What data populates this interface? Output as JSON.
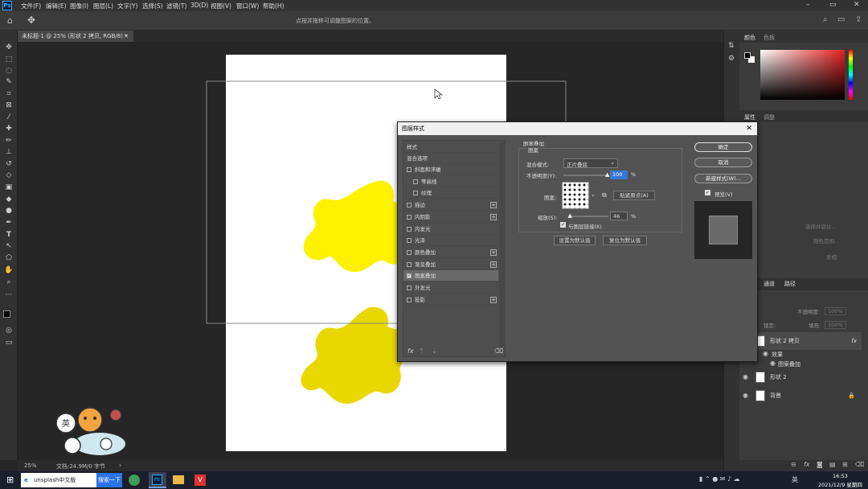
{
  "app": {
    "logo": "Ps",
    "hint": "点按并拖移可调整图案的位置。"
  },
  "menu": [
    "文件(F)",
    "编辑(E)",
    "图像(I)",
    "图层(L)",
    "文字(Y)",
    "选择(S)",
    "滤镜(T)",
    "3D(D)",
    "视图(V)",
    "窗口(W)",
    "帮助(H)"
  ],
  "doc": {
    "tab": "未标题-1 @ 25% (形状 2 拷贝, RGB/8) *",
    "close": "×",
    "zoom": "25%",
    "info": "文档:24.9M/0 字节"
  },
  "panels": {
    "color_tab": "颜色",
    "swatch_tab": "色板",
    "props_tab": "属性",
    "adjust_tab": "调整",
    "channels_tab": "通道",
    "paths_tab": "路径",
    "opacity_label": "不透明度:",
    "opacity_value": "100%",
    "fill_label": "填充:",
    "fill_value": "100%",
    "lock_label": "锁定:"
  },
  "layers": [
    {
      "name": "形状 2 拷贝",
      "fx": "fx"
    },
    {
      "name": "效果"
    },
    {
      "name": "图案叠加"
    },
    {
      "name": "形状 2"
    },
    {
      "name": "背景"
    }
  ],
  "dialog": {
    "title": "图层样式",
    "close": "✕",
    "styles_header": "样式",
    "blend_options": "混合选项",
    "effects": [
      {
        "label": "斜面和浮雕",
        "plus": false,
        "checked": false
      },
      {
        "label": "等高线",
        "plus": false,
        "checked": false,
        "indent": true
      },
      {
        "label": "纹理",
        "plus": false,
        "checked": false,
        "indent": true
      },
      {
        "label": "描边",
        "plus": true,
        "checked": false
      },
      {
        "label": "内阴影",
        "plus": true,
        "checked": false
      },
      {
        "label": "内发光",
        "plus": false,
        "checked": false
      },
      {
        "label": "光泽",
        "plus": false,
        "checked": false
      },
      {
        "label": "颜色叠加",
        "plus": true,
        "checked": false
      },
      {
        "label": "渐变叠加",
        "plus": true,
        "checked": false
      },
      {
        "label": "图案叠加",
        "plus": false,
        "checked": true
      },
      {
        "label": "外发光",
        "plus": false,
        "checked": false
      },
      {
        "label": "投影",
        "plus": true,
        "checked": false
      }
    ],
    "section_title": "图案叠加",
    "group_title": "图案",
    "blend_mode_label": "混合模式:",
    "blend_mode_value": "正片叠底",
    "opacity_label": "不透明度(Y):",
    "opacity_value": "100",
    "opacity_pct": "%",
    "opacity_level": 1.0,
    "pattern_label": "图案:",
    "snap_origin": "贴紧原点(A)",
    "scale_label": "缩放(S):",
    "scale_value": "46",
    "scale_pct": "%",
    "scale_level": 0.03,
    "link_label": "与图层链接(K)",
    "set_default": "设置为默认值",
    "reset_default": "复位为默认值",
    "ok": "确定",
    "cancel": "取消",
    "new_style": "新建样式(W)...",
    "preview": "预览(V)",
    "fx_footer": "fx"
  },
  "ghost": {
    "select_subject": "选择并遮住...",
    "color_range": "颜色范围...",
    "invert": "反相"
  },
  "taskbar": {
    "search": "unsplash中文版",
    "search_btn": "搜索一下",
    "lang": "英",
    "time": "16:53",
    "date": "2021/12/9 星期四"
  },
  "colors": {
    "accent": "#31a8ff",
    "blob_top": "#fff200",
    "blob_bottom": "#e8d800"
  }
}
